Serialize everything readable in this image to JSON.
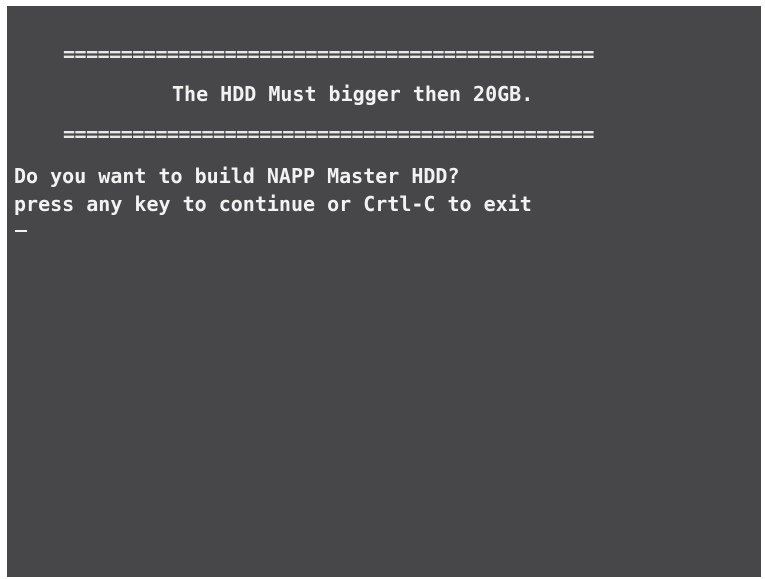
{
  "console": {
    "separator_top": "==============================================",
    "title": "The HDD Must bigger then 20GB.",
    "separator_bottom": "==============================================",
    "prompt_question": "Do you want to build NAPP Master HDD?",
    "prompt_instruction": "press any key to continue or Crtl-C to exit",
    "background_color": "#474649",
    "text_color": "#f2f2f2"
  }
}
